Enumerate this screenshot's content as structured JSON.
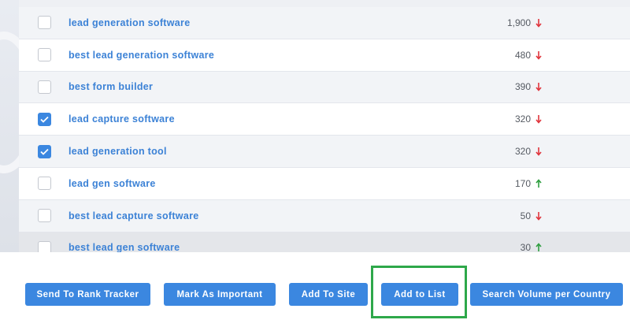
{
  "keywords": [
    {
      "keyword": "lead generation software",
      "volume": "1,900",
      "trend": "down",
      "checked": false
    },
    {
      "keyword": "best lead generation software",
      "volume": "480",
      "trend": "down",
      "checked": false
    },
    {
      "keyword": "best form builder",
      "volume": "390",
      "trend": "down",
      "checked": false
    },
    {
      "keyword": "lead capture software",
      "volume": "320",
      "trend": "down",
      "checked": true
    },
    {
      "keyword": "lead generation tool",
      "volume": "320",
      "trend": "down",
      "checked": true
    },
    {
      "keyword": "lead gen software",
      "volume": "170",
      "trend": "up",
      "checked": false
    },
    {
      "keyword": "best lead capture software",
      "volume": "50",
      "trend": "down",
      "checked": false
    },
    {
      "keyword": "best lead gen software",
      "volume": "30",
      "trend": "up",
      "checked": false
    }
  ],
  "actions": {
    "send_to_rank_tracker": "Send To Rank Tracker",
    "mark_as_important": "Mark As Important",
    "add_to_site": "Add To Site",
    "add_to_list": "Add to List",
    "search_volume_per_country": "Search Volume per Country"
  },
  "colors": {
    "accent": "#3b87e0",
    "keyword_link": "#3c82d6",
    "trend_down": "#e0333b",
    "trend_up": "#2e9e3f",
    "highlight": "#2ea84a"
  },
  "icons": {
    "trend_down": "arrow-down-icon",
    "trend_up": "arrow-up-icon",
    "check": "checkmark-icon"
  }
}
